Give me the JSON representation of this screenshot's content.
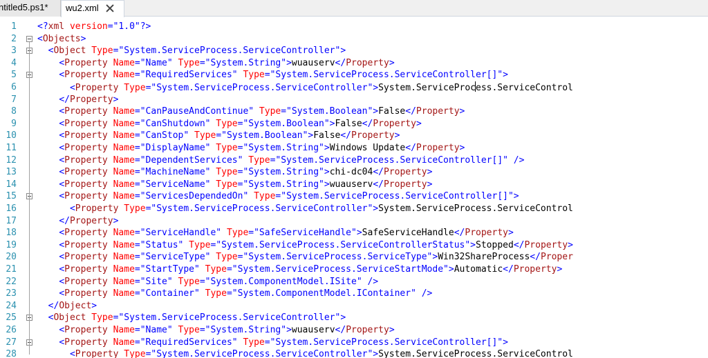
{
  "tabs": [
    {
      "label": "ntitled5.ps1*",
      "active": false
    },
    {
      "label": "wu2.xml",
      "active": true
    }
  ],
  "editor": {
    "fold_lines": [
      2,
      3,
      5,
      15,
      25,
      27
    ],
    "lines": [
      {
        "n": "1",
        "indent": 0,
        "tokens": [
          [
            "b",
            "<?"
          ],
          [
            "m",
            "xml"
          ],
          [
            "a",
            " version"
          ],
          [
            "b",
            "=\"1.0\"?>"
          ]
        ]
      },
      {
        "n": "2",
        "indent": 0,
        "tokens": [
          [
            "b",
            "<"
          ],
          [
            "m",
            "Objects"
          ],
          [
            "b",
            ">"
          ]
        ]
      },
      {
        "n": "3",
        "indent": 1,
        "tokens": [
          [
            "b",
            "<"
          ],
          [
            "m",
            "Object"
          ],
          [
            "a",
            " Type"
          ],
          [
            "b",
            "=\"System.ServiceProcess.ServiceController\">"
          ]
        ]
      },
      {
        "n": "4",
        "indent": 2,
        "tokens": [
          [
            "b",
            "<"
          ],
          [
            "m",
            "Property"
          ],
          [
            "a",
            " Name"
          ],
          [
            "b",
            "=\"Name\""
          ],
          [
            "a",
            " Type"
          ],
          [
            "b",
            "=\"System.String\">"
          ],
          [
            "t",
            "wuauserv"
          ],
          [
            "b",
            "</"
          ],
          [
            "m",
            "Property"
          ],
          [
            "b",
            ">"
          ]
        ]
      },
      {
        "n": "5",
        "indent": 2,
        "tokens": [
          [
            "b",
            "<"
          ],
          [
            "m",
            "Property"
          ],
          [
            "a",
            " Name"
          ],
          [
            "b",
            "=\"RequiredServices\""
          ],
          [
            "a",
            " Type"
          ],
          [
            "b",
            "=\"System.ServiceProcess.ServiceController[]\">"
          ]
        ]
      },
      {
        "n": "6",
        "indent": 3,
        "tokens": [
          [
            "b",
            "<"
          ],
          [
            "m",
            "Property"
          ],
          [
            "a",
            " Type"
          ],
          [
            "b",
            "=\"System.ServiceProcess.ServiceController\">"
          ],
          [
            "t",
            "System.ServiceProc"
          ],
          [
            "caret",
            ""
          ],
          [
            "t",
            "ess.ServiceControl"
          ]
        ]
      },
      {
        "n": "7",
        "indent": 2,
        "tokens": [
          [
            "b",
            "</"
          ],
          [
            "m",
            "Property"
          ],
          [
            "b",
            ">"
          ]
        ]
      },
      {
        "n": "8",
        "indent": 2,
        "tokens": [
          [
            "b",
            "<"
          ],
          [
            "m",
            "Property"
          ],
          [
            "a",
            " Name"
          ],
          [
            "b",
            "=\"CanPauseAndContinue\""
          ],
          [
            "a",
            " Type"
          ],
          [
            "b",
            "=\"System.Boolean\">"
          ],
          [
            "t",
            "False"
          ],
          [
            "b",
            "</"
          ],
          [
            "m",
            "Property"
          ],
          [
            "b",
            ">"
          ]
        ]
      },
      {
        "n": "9",
        "indent": 2,
        "tokens": [
          [
            "b",
            "<"
          ],
          [
            "m",
            "Property"
          ],
          [
            "a",
            " Name"
          ],
          [
            "b",
            "=\"CanShutdown\""
          ],
          [
            "a",
            " Type"
          ],
          [
            "b",
            "=\"System.Boolean\">"
          ],
          [
            "t",
            "False"
          ],
          [
            "b",
            "</"
          ],
          [
            "m",
            "Property"
          ],
          [
            "b",
            ">"
          ]
        ]
      },
      {
        "n": "10",
        "indent": 2,
        "tokens": [
          [
            "b",
            "<"
          ],
          [
            "m",
            "Property"
          ],
          [
            "a",
            " Name"
          ],
          [
            "b",
            "=\"CanStop\""
          ],
          [
            "a",
            " Type"
          ],
          [
            "b",
            "=\"System.Boolean\">"
          ],
          [
            "t",
            "False"
          ],
          [
            "b",
            "</"
          ],
          [
            "m",
            "Property"
          ],
          [
            "b",
            ">"
          ]
        ]
      },
      {
        "n": "11",
        "indent": 2,
        "tokens": [
          [
            "b",
            "<"
          ],
          [
            "m",
            "Property"
          ],
          [
            "a",
            " Name"
          ],
          [
            "b",
            "=\"DisplayName\""
          ],
          [
            "a",
            " Type"
          ],
          [
            "b",
            "=\"System.String\">"
          ],
          [
            "t",
            "Windows Update"
          ],
          [
            "b",
            "</"
          ],
          [
            "m",
            "Property"
          ],
          [
            "b",
            ">"
          ]
        ]
      },
      {
        "n": "12",
        "indent": 2,
        "tokens": [
          [
            "b",
            "<"
          ],
          [
            "m",
            "Property"
          ],
          [
            "a",
            " Name"
          ],
          [
            "b",
            "=\"DependentServices\""
          ],
          [
            "a",
            " Type"
          ],
          [
            "b",
            "=\"System.ServiceProcess.ServiceController[]\""
          ],
          [
            "b",
            " />"
          ]
        ]
      },
      {
        "n": "13",
        "indent": 2,
        "tokens": [
          [
            "b",
            "<"
          ],
          [
            "m",
            "Property"
          ],
          [
            "a",
            " Name"
          ],
          [
            "b",
            "=\"MachineName\""
          ],
          [
            "a",
            " Type"
          ],
          [
            "b",
            "=\"System.String\">"
          ],
          [
            "t",
            "chi-dc04"
          ],
          [
            "b",
            "</"
          ],
          [
            "m",
            "Property"
          ],
          [
            "b",
            ">"
          ]
        ]
      },
      {
        "n": "14",
        "indent": 2,
        "tokens": [
          [
            "b",
            "<"
          ],
          [
            "m",
            "Property"
          ],
          [
            "a",
            " Name"
          ],
          [
            "b",
            "=\"ServiceName\""
          ],
          [
            "a",
            " Type"
          ],
          [
            "b",
            "=\"System.String\">"
          ],
          [
            "t",
            "wuauserv"
          ],
          [
            "b",
            "</"
          ],
          [
            "m",
            "Property"
          ],
          [
            "b",
            ">"
          ]
        ]
      },
      {
        "n": "15",
        "indent": 2,
        "tokens": [
          [
            "b",
            "<"
          ],
          [
            "m",
            "Property"
          ],
          [
            "a",
            " Name"
          ],
          [
            "b",
            "=\"ServicesDependedOn\""
          ],
          [
            "a",
            " Type"
          ],
          [
            "b",
            "=\"System.ServiceProcess.ServiceController[]\">"
          ]
        ]
      },
      {
        "n": "16",
        "indent": 3,
        "tokens": [
          [
            "b",
            "<"
          ],
          [
            "m",
            "Property"
          ],
          [
            "a",
            " Type"
          ],
          [
            "b",
            "=\"System.ServiceProcess.ServiceController\">"
          ],
          [
            "t",
            "System.ServiceProcess.ServiceControl"
          ]
        ]
      },
      {
        "n": "17",
        "indent": 2,
        "tokens": [
          [
            "b",
            "</"
          ],
          [
            "m",
            "Property"
          ],
          [
            "b",
            ">"
          ]
        ]
      },
      {
        "n": "18",
        "indent": 2,
        "tokens": [
          [
            "b",
            "<"
          ],
          [
            "m",
            "Property"
          ],
          [
            "a",
            " Name"
          ],
          [
            "b",
            "=\"ServiceHandle\""
          ],
          [
            "a",
            " Type"
          ],
          [
            "b",
            "=\"SafeServiceHandle\">"
          ],
          [
            "t",
            "SafeServiceHandle"
          ],
          [
            "b",
            "</"
          ],
          [
            "m",
            "Property"
          ],
          [
            "b",
            ">"
          ]
        ]
      },
      {
        "n": "19",
        "indent": 2,
        "tokens": [
          [
            "b",
            "<"
          ],
          [
            "m",
            "Property"
          ],
          [
            "a",
            " Name"
          ],
          [
            "b",
            "=\"Status\""
          ],
          [
            "a",
            " Type"
          ],
          [
            "b",
            "=\"System.ServiceProcess.ServiceControllerStatus\">"
          ],
          [
            "t",
            "Stopped"
          ],
          [
            "b",
            "</"
          ],
          [
            "m",
            "Property"
          ],
          [
            "b",
            ">"
          ]
        ]
      },
      {
        "n": "20",
        "indent": 2,
        "tokens": [
          [
            "b",
            "<"
          ],
          [
            "m",
            "Property"
          ],
          [
            "a",
            " Name"
          ],
          [
            "b",
            "=\"ServiceType\""
          ],
          [
            "a",
            " Type"
          ],
          [
            "b",
            "=\"System.ServiceProcess.ServiceType\">"
          ],
          [
            "t",
            "Win32ShareProcess"
          ],
          [
            "b",
            "</"
          ],
          [
            "m",
            "Proper"
          ]
        ]
      },
      {
        "n": "21",
        "indent": 2,
        "tokens": [
          [
            "b",
            "<"
          ],
          [
            "m",
            "Property"
          ],
          [
            "a",
            " Name"
          ],
          [
            "b",
            "=\"StartType\""
          ],
          [
            "a",
            " Type"
          ],
          [
            "b",
            "=\"System.ServiceProcess.ServiceStartMode\">"
          ],
          [
            "t",
            "Automatic"
          ],
          [
            "b",
            "</"
          ],
          [
            "m",
            "Property"
          ],
          [
            "b",
            ">"
          ]
        ]
      },
      {
        "n": "22",
        "indent": 2,
        "tokens": [
          [
            "b",
            "<"
          ],
          [
            "m",
            "Property"
          ],
          [
            "a",
            " Name"
          ],
          [
            "b",
            "=\"Site\""
          ],
          [
            "a",
            " Type"
          ],
          [
            "b",
            "=\"System.ComponentModel.ISite\""
          ],
          [
            "b",
            " />"
          ]
        ]
      },
      {
        "n": "23",
        "indent": 2,
        "tokens": [
          [
            "b",
            "<"
          ],
          [
            "m",
            "Property"
          ],
          [
            "a",
            " Name"
          ],
          [
            "b",
            "=\"Container\""
          ],
          [
            "a",
            " Type"
          ],
          [
            "b",
            "=\"System.ComponentModel.IContainer\""
          ],
          [
            "b",
            " />"
          ]
        ]
      },
      {
        "n": "24",
        "indent": 1,
        "tokens": [
          [
            "b",
            "</"
          ],
          [
            "m",
            "Object"
          ],
          [
            "b",
            ">"
          ]
        ]
      },
      {
        "n": "25",
        "indent": 1,
        "tokens": [
          [
            "b",
            "<"
          ],
          [
            "m",
            "Object"
          ],
          [
            "a",
            " Type"
          ],
          [
            "b",
            "=\"System.ServiceProcess.ServiceController\">"
          ]
        ]
      },
      {
        "n": "26",
        "indent": 2,
        "tokens": [
          [
            "b",
            "<"
          ],
          [
            "m",
            "Property"
          ],
          [
            "a",
            " Name"
          ],
          [
            "b",
            "=\"Name\""
          ],
          [
            "a",
            " Type"
          ],
          [
            "b",
            "=\"System.String\">"
          ],
          [
            "t",
            "wuauserv"
          ],
          [
            "b",
            "</"
          ],
          [
            "m",
            "Property"
          ],
          [
            "b",
            ">"
          ]
        ]
      },
      {
        "n": "27",
        "indent": 2,
        "tokens": [
          [
            "b",
            "<"
          ],
          [
            "m",
            "Property"
          ],
          [
            "a",
            " Name"
          ],
          [
            "b",
            "=\"RequiredServices\""
          ],
          [
            "a",
            " Type"
          ],
          [
            "b",
            "=\"System.ServiceProcess.ServiceController[]\">"
          ]
        ]
      },
      {
        "n": "28",
        "indent": 3,
        "tokens": [
          [
            "b",
            "<"
          ],
          [
            "m",
            "Property"
          ],
          [
            "a",
            " Type"
          ],
          [
            "b",
            "=\"System.ServiceProcess.ServiceController\">"
          ],
          [
            "t",
            "System.ServiceProcess.ServiceControl"
          ]
        ]
      }
    ]
  }
}
